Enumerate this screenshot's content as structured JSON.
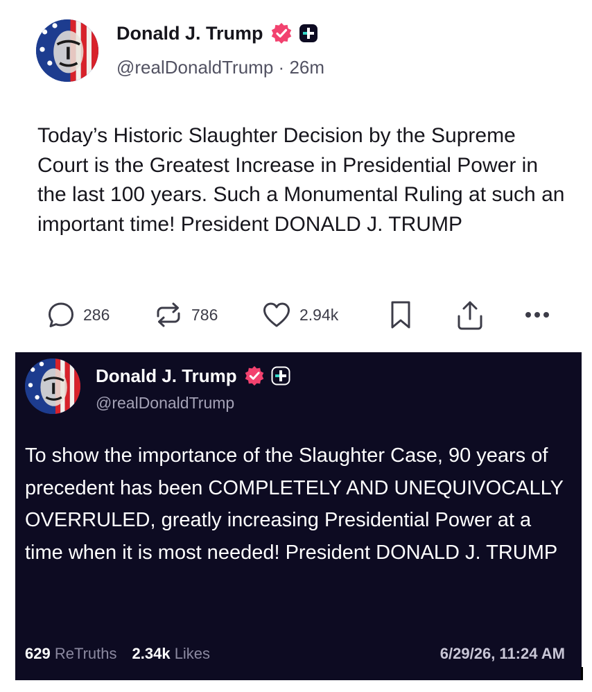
{
  "posts": [
    {
      "author": {
        "name": "Donald J. Trump",
        "handle": "@realDonaldTrump",
        "separator": "·",
        "time": "26m"
      },
      "text": "Today’s Historic Slaughter Decision by the Supreme Court is the Greatest Increase in Presidential Power in the last 100 years. Such a Monumental Ruling at such an important time! President DONALD J. TRUMP",
      "actions": {
        "replies": "286",
        "retruths": "786",
        "likes": "2.94k"
      },
      "icons": [
        "reply-icon",
        "retruth-icon",
        "like-icon",
        "bookmark-icon",
        "share-icon",
        "more-icon"
      ]
    },
    {
      "author": {
        "name": "Donald J. Trump",
        "handle": "@realDonaldTrump"
      },
      "text": "To show the importance of the Slaughter Case, 90 years of precedent has been COMPLETELY AND UNEQUIVOCALLY OVERRULED, greatly increasing Presidential Power at a time when it is most needed! President DONALD J. TRUMP",
      "stats": {
        "retruths_count": "629",
        "retruths_label": "ReTruths",
        "likes_count": "2.34k",
        "likes_label": "Likes"
      },
      "timestamp": "6/29/26, 11:24 AM"
    }
  ],
  "colors": {
    "verified_badge": "#f2426f",
    "dark_background": "#0d0b22",
    "plus_badge_accent": "#35d6c8"
  }
}
